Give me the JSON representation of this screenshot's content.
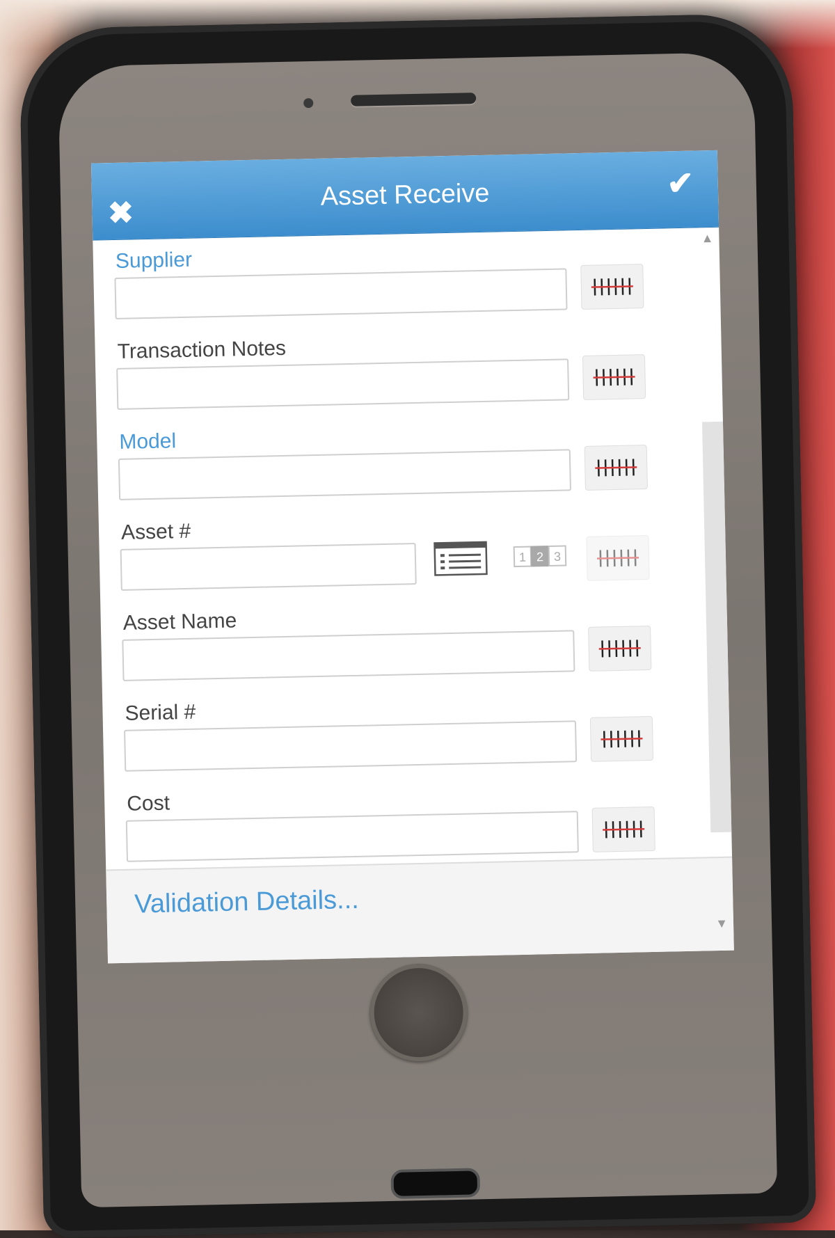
{
  "header": {
    "title": "Asset Receive",
    "close_icon": "close-icon",
    "confirm_icon": "checkmark-icon"
  },
  "fields": [
    {
      "label": "Supplier",
      "required": true,
      "value": ""
    },
    {
      "label": "Transaction Notes",
      "required": false,
      "value": ""
    },
    {
      "label": "Model",
      "required": true,
      "value": ""
    },
    {
      "label": "Asset #",
      "required": false,
      "value": ""
    },
    {
      "label": "Asset Name",
      "required": false,
      "value": ""
    },
    {
      "label": "Serial #",
      "required": false,
      "value": ""
    },
    {
      "label": "Cost",
      "required": false,
      "value": ""
    }
  ],
  "asset_number_buttons": {
    "list_icon": "list-icon",
    "sequence_icon": "sequence-icon",
    "sequence_digits": [
      "1",
      "2",
      "3"
    ]
  },
  "barcode_icon": "barcode-icon",
  "footer": {
    "validation_link": "Validation Details..."
  },
  "colors": {
    "header_blue": "#3c8dcd",
    "required_label": "#4a9ad8",
    "barcode_red": "#d33a3a"
  }
}
